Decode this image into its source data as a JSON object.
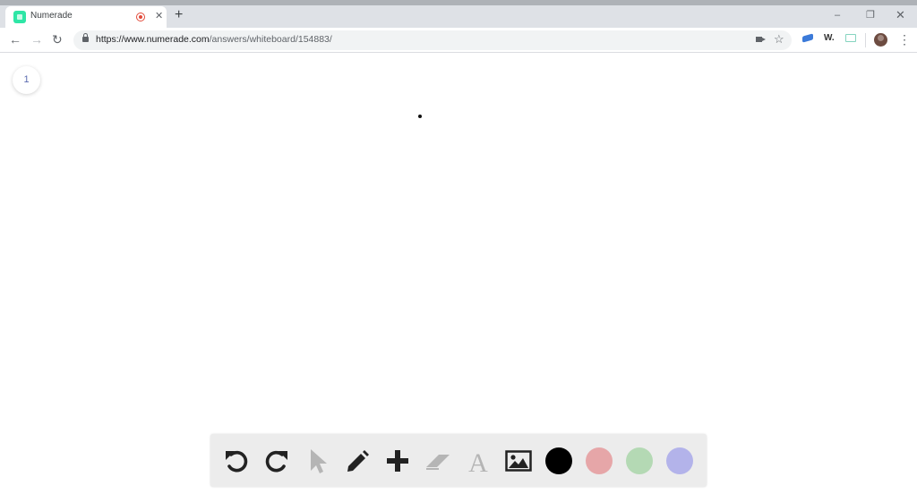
{
  "browser": {
    "tab": {
      "title": "Numerade",
      "close_glyph": "✕"
    },
    "new_tab_glyph": "+",
    "window_controls": {
      "minimize": "–",
      "restore": "❐",
      "close": "✕"
    },
    "nav": {
      "back": "←",
      "forward": "→",
      "reload": "↻"
    },
    "address": {
      "host": "https://www.numerade.com",
      "path": "/answers/whiteboard/154883/"
    },
    "star_glyph": "☆",
    "extension_w": "W.",
    "menu_glyph": "⋮"
  },
  "page": {
    "page_number": "1"
  },
  "toolbar": {
    "tools": [
      {
        "name": "undo",
        "icon": "undo-icon",
        "color": "#222222"
      },
      {
        "name": "redo",
        "icon": "redo-icon",
        "color": "#222222"
      },
      {
        "name": "select",
        "icon": "cursor-icon",
        "color": "#b5b5b5"
      },
      {
        "name": "pen",
        "icon": "pencil-icon",
        "color": "#222222"
      },
      {
        "name": "add",
        "icon": "plus-icon",
        "color": "#222222"
      },
      {
        "name": "eraser",
        "icon": "eraser-icon",
        "color": "#b5b5b5"
      },
      {
        "name": "text",
        "icon": "text-icon",
        "color": "#b5b5b5"
      },
      {
        "name": "image",
        "icon": "image-icon",
        "color": "#222222"
      }
    ],
    "text_tool_glyph": "A",
    "colors": [
      "#000000",
      "#e6a6a8",
      "#b4d9b4",
      "#b3b3ea"
    ]
  }
}
